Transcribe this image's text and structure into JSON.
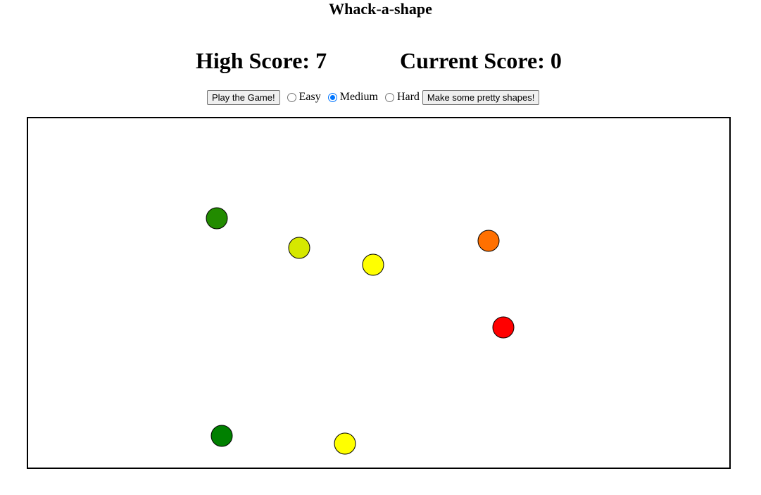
{
  "title": "Whack-a-shape",
  "scores": {
    "high_score": "High Score: 7",
    "current_score": "Current Score: 0"
  },
  "controls": {
    "play_button": "Play the Game!",
    "difficulty": {
      "options": [
        "Easy",
        "Medium",
        "Hard"
      ],
      "selected": "Medium"
    },
    "pretty_shapes_button": "Make some pretty shapes!"
  },
  "shapes": [
    {
      "color": "#228B00"
    },
    {
      "color": "#D6E800"
    },
    {
      "color": "#FFFF00"
    },
    {
      "color": "#FF7000"
    },
    {
      "color": "#FF0000"
    },
    {
      "color": "#008000"
    },
    {
      "color": "#FFFF00"
    }
  ]
}
